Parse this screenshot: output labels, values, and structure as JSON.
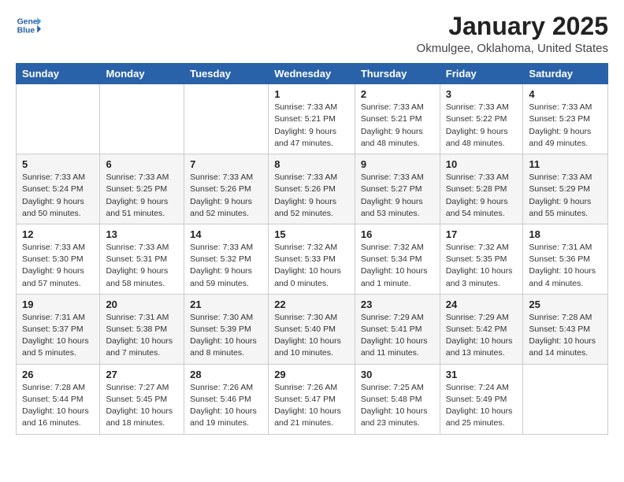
{
  "header": {
    "logo_general": "General",
    "logo_blue": "Blue",
    "month_year": "January 2025",
    "location": "Okmulgee, Oklahoma, United States"
  },
  "weekdays": [
    "Sunday",
    "Monday",
    "Tuesday",
    "Wednesday",
    "Thursday",
    "Friday",
    "Saturday"
  ],
  "weeks": [
    [
      {
        "day": "",
        "info": ""
      },
      {
        "day": "",
        "info": ""
      },
      {
        "day": "",
        "info": ""
      },
      {
        "day": "1",
        "info": "Sunrise: 7:33 AM\nSunset: 5:21 PM\nDaylight: 9 hours\nand 47 minutes."
      },
      {
        "day": "2",
        "info": "Sunrise: 7:33 AM\nSunset: 5:21 PM\nDaylight: 9 hours\nand 48 minutes."
      },
      {
        "day": "3",
        "info": "Sunrise: 7:33 AM\nSunset: 5:22 PM\nDaylight: 9 hours\nand 48 minutes."
      },
      {
        "day": "4",
        "info": "Sunrise: 7:33 AM\nSunset: 5:23 PM\nDaylight: 9 hours\nand 49 minutes."
      }
    ],
    [
      {
        "day": "5",
        "info": "Sunrise: 7:33 AM\nSunset: 5:24 PM\nDaylight: 9 hours\nand 50 minutes."
      },
      {
        "day": "6",
        "info": "Sunrise: 7:33 AM\nSunset: 5:25 PM\nDaylight: 9 hours\nand 51 minutes."
      },
      {
        "day": "7",
        "info": "Sunrise: 7:33 AM\nSunset: 5:26 PM\nDaylight: 9 hours\nand 52 minutes."
      },
      {
        "day": "8",
        "info": "Sunrise: 7:33 AM\nSunset: 5:26 PM\nDaylight: 9 hours\nand 52 minutes."
      },
      {
        "day": "9",
        "info": "Sunrise: 7:33 AM\nSunset: 5:27 PM\nDaylight: 9 hours\nand 53 minutes."
      },
      {
        "day": "10",
        "info": "Sunrise: 7:33 AM\nSunset: 5:28 PM\nDaylight: 9 hours\nand 54 minutes."
      },
      {
        "day": "11",
        "info": "Sunrise: 7:33 AM\nSunset: 5:29 PM\nDaylight: 9 hours\nand 55 minutes."
      }
    ],
    [
      {
        "day": "12",
        "info": "Sunrise: 7:33 AM\nSunset: 5:30 PM\nDaylight: 9 hours\nand 57 minutes."
      },
      {
        "day": "13",
        "info": "Sunrise: 7:33 AM\nSunset: 5:31 PM\nDaylight: 9 hours\nand 58 minutes."
      },
      {
        "day": "14",
        "info": "Sunrise: 7:33 AM\nSunset: 5:32 PM\nDaylight: 9 hours\nand 59 minutes."
      },
      {
        "day": "15",
        "info": "Sunrise: 7:32 AM\nSunset: 5:33 PM\nDaylight: 10 hours\nand 0 minutes."
      },
      {
        "day": "16",
        "info": "Sunrise: 7:32 AM\nSunset: 5:34 PM\nDaylight: 10 hours\nand 1 minute."
      },
      {
        "day": "17",
        "info": "Sunrise: 7:32 AM\nSunset: 5:35 PM\nDaylight: 10 hours\nand 3 minutes."
      },
      {
        "day": "18",
        "info": "Sunrise: 7:31 AM\nSunset: 5:36 PM\nDaylight: 10 hours\nand 4 minutes."
      }
    ],
    [
      {
        "day": "19",
        "info": "Sunrise: 7:31 AM\nSunset: 5:37 PM\nDaylight: 10 hours\nand 5 minutes."
      },
      {
        "day": "20",
        "info": "Sunrise: 7:31 AM\nSunset: 5:38 PM\nDaylight: 10 hours\nand 7 minutes."
      },
      {
        "day": "21",
        "info": "Sunrise: 7:30 AM\nSunset: 5:39 PM\nDaylight: 10 hours\nand 8 minutes."
      },
      {
        "day": "22",
        "info": "Sunrise: 7:30 AM\nSunset: 5:40 PM\nDaylight: 10 hours\nand 10 minutes."
      },
      {
        "day": "23",
        "info": "Sunrise: 7:29 AM\nSunset: 5:41 PM\nDaylight: 10 hours\nand 11 minutes."
      },
      {
        "day": "24",
        "info": "Sunrise: 7:29 AM\nSunset: 5:42 PM\nDaylight: 10 hours\nand 13 minutes."
      },
      {
        "day": "25",
        "info": "Sunrise: 7:28 AM\nSunset: 5:43 PM\nDaylight: 10 hours\nand 14 minutes."
      }
    ],
    [
      {
        "day": "26",
        "info": "Sunrise: 7:28 AM\nSunset: 5:44 PM\nDaylight: 10 hours\nand 16 minutes."
      },
      {
        "day": "27",
        "info": "Sunrise: 7:27 AM\nSunset: 5:45 PM\nDaylight: 10 hours\nand 18 minutes."
      },
      {
        "day": "28",
        "info": "Sunrise: 7:26 AM\nSunset: 5:46 PM\nDaylight: 10 hours\nand 19 minutes."
      },
      {
        "day": "29",
        "info": "Sunrise: 7:26 AM\nSunset: 5:47 PM\nDaylight: 10 hours\nand 21 minutes."
      },
      {
        "day": "30",
        "info": "Sunrise: 7:25 AM\nSunset: 5:48 PM\nDaylight: 10 hours\nand 23 minutes."
      },
      {
        "day": "31",
        "info": "Sunrise: 7:24 AM\nSunset: 5:49 PM\nDaylight: 10 hours\nand 25 minutes."
      },
      {
        "day": "",
        "info": ""
      }
    ]
  ]
}
